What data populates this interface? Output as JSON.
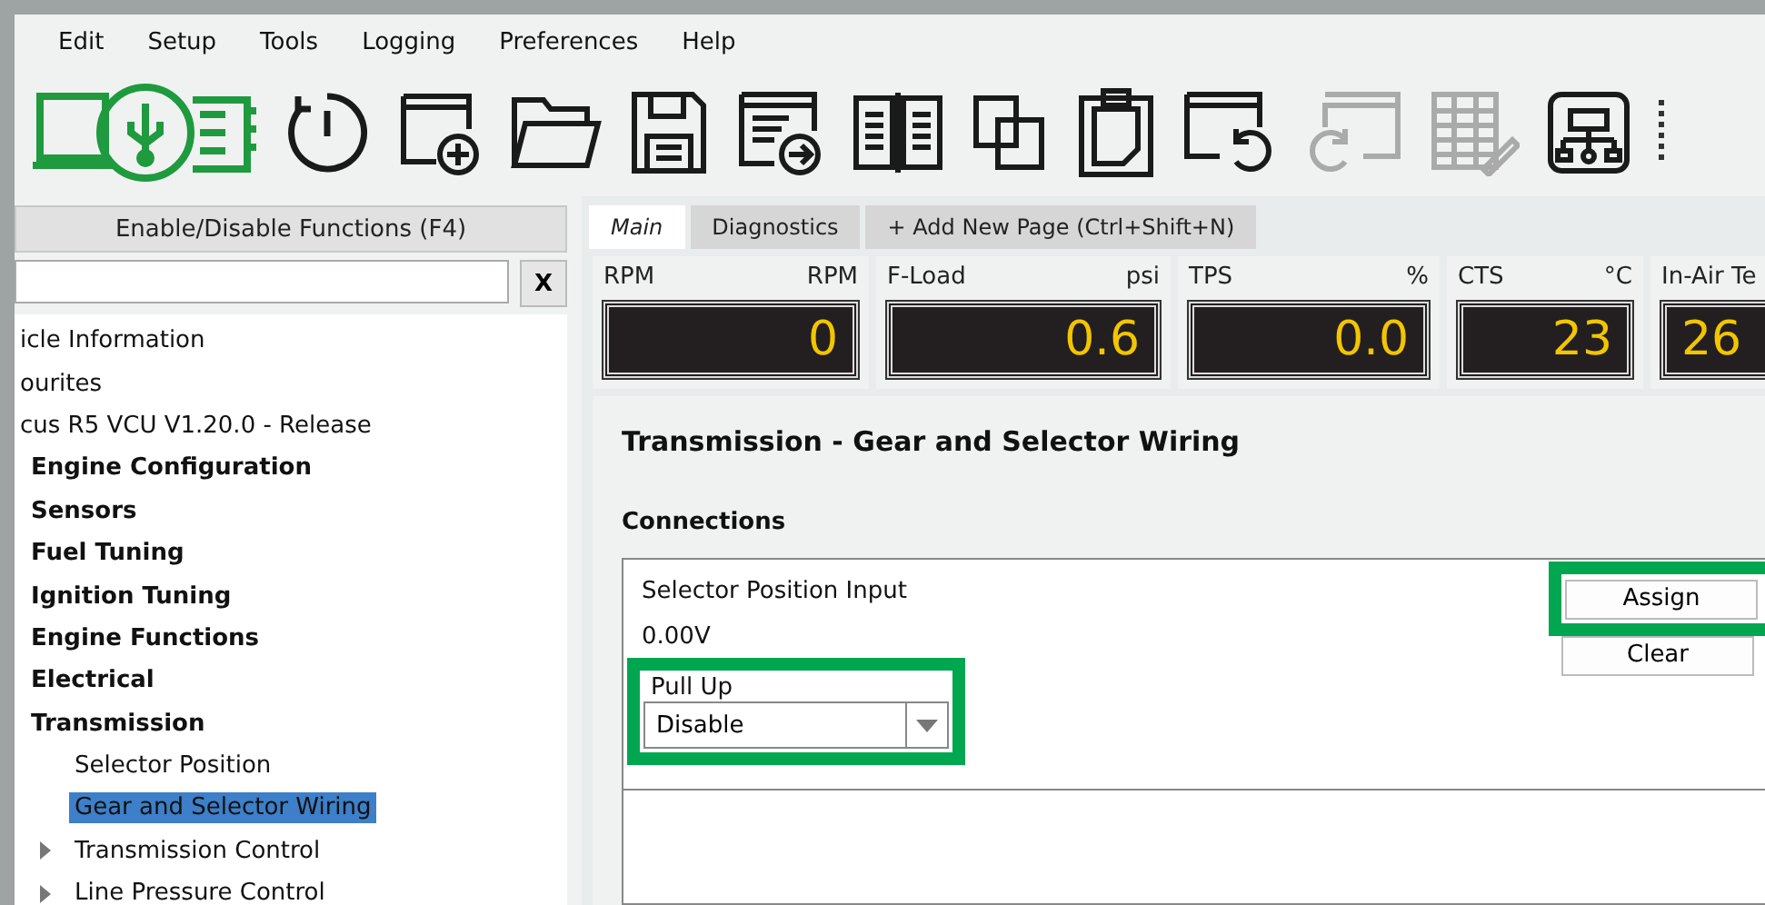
{
  "menu": [
    {
      "label": "Edit"
    },
    {
      "label": "Setup"
    },
    {
      "label": "Tools"
    },
    {
      "label": "Logging"
    },
    {
      "label": "Preferences"
    },
    {
      "label": "Help"
    }
  ],
  "toolbar": [
    {
      "kind": "usb",
      "disabled": false
    },
    {
      "kind": "power",
      "disabled": false
    },
    {
      "kind": "new",
      "disabled": false
    },
    {
      "kind": "open",
      "disabled": false
    },
    {
      "kind": "save",
      "disabled": false
    },
    {
      "kind": "export",
      "disabled": false
    },
    {
      "kind": "columns",
      "disabled": false
    },
    {
      "kind": "copy",
      "disabled": false
    },
    {
      "kind": "paste",
      "disabled": false
    },
    {
      "kind": "undo",
      "disabled": false
    },
    {
      "kind": "redo",
      "disabled": true
    },
    {
      "kind": "table",
      "disabled": true
    },
    {
      "kind": "network",
      "disabled": false
    }
  ],
  "sidebar": {
    "functions_button": "Enable/Disable Functions (F4)",
    "clear_button": "X",
    "tree": [
      {
        "label": "icle Information"
      },
      {
        "label": "ourites"
      },
      {
        "label": "cus R5 VCU V1.20.0 - Release",
        "children": [
          {
            "label": "Engine Configuration"
          },
          {
            "label": "Sensors"
          },
          {
            "label": "Fuel Tuning"
          },
          {
            "label": "Ignition Tuning"
          },
          {
            "label": "Engine Functions"
          },
          {
            "label": "Electrical"
          },
          {
            "label": "Transmission",
            "children": [
              {
                "label": "Selector Position",
                "selected": false
              },
              {
                "label": "Gear and Selector Wiring",
                "selected": true
              },
              {
                "label": "Transmission Control",
                "selected": false,
                "expanded": false
              },
              {
                "label": "Line Pressure Control",
                "selected": false,
                "expanded": false
              }
            ]
          }
        ]
      }
    ]
  },
  "tabs": [
    {
      "label": "Main",
      "selected": true
    },
    {
      "label": "Diagnostics",
      "selected": false
    },
    {
      "label": "+ Add New Page (Ctrl+Shift+N)",
      "selected": false
    }
  ],
  "gauges": [
    {
      "label": "RPM",
      "unit": "RPM",
      "value": "0"
    },
    {
      "label": "F-Load",
      "unit": "psi",
      "value": "0.6"
    },
    {
      "label": "TPS",
      "unit": "%",
      "value": "0.0"
    },
    {
      "label": "CTS",
      "unit": "°C",
      "value": "23"
    },
    {
      "label": "In-Air Te",
      "value": "26"
    }
  ],
  "page": {
    "title": "Transmission - Gear and Selector Wiring",
    "section": "Connections",
    "connection": {
      "name": "Selector Position Input",
      "reading": "0.00V",
      "assign_button": "Assign",
      "clear_button": "Clear",
      "pull_up": {
        "label": "Pull Up",
        "value": "Disable"
      }
    }
  }
}
